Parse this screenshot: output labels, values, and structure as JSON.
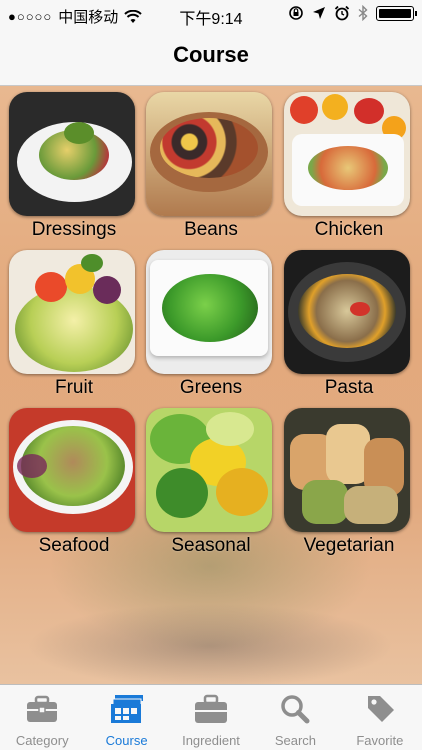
{
  "status_bar": {
    "signal_dots": "●○○○○",
    "carrier": "中国移动",
    "time": "下午9:14",
    "icons": [
      "wifi-icon",
      "orientation-lock-icon",
      "location-icon",
      "alarm-icon",
      "bluetooth-icon",
      "battery-icon"
    ]
  },
  "nav": {
    "title": "Course"
  },
  "courses": [
    {
      "label": "Dressings"
    },
    {
      "label": "Beans"
    },
    {
      "label": "Chicken"
    },
    {
      "label": "Fruit"
    },
    {
      "label": "Greens"
    },
    {
      "label": "Pasta"
    },
    {
      "label": "Seafood"
    },
    {
      "label": "Seasonal"
    },
    {
      "label": "Vegetarian"
    }
  ],
  "tabs": [
    {
      "label": "Category",
      "icon": "toolbox-icon",
      "active": false
    },
    {
      "label": "Course",
      "icon": "cards-icon",
      "active": true
    },
    {
      "label": "Ingredient",
      "icon": "briefcase-icon",
      "active": false
    },
    {
      "label": "Search",
      "icon": "magnifier-icon",
      "active": false
    },
    {
      "label": "Favorite",
      "icon": "tag-icon",
      "active": false
    }
  ],
  "colors": {
    "accent": "#1a7ad8",
    "inactive": "#8e8e8e"
  }
}
